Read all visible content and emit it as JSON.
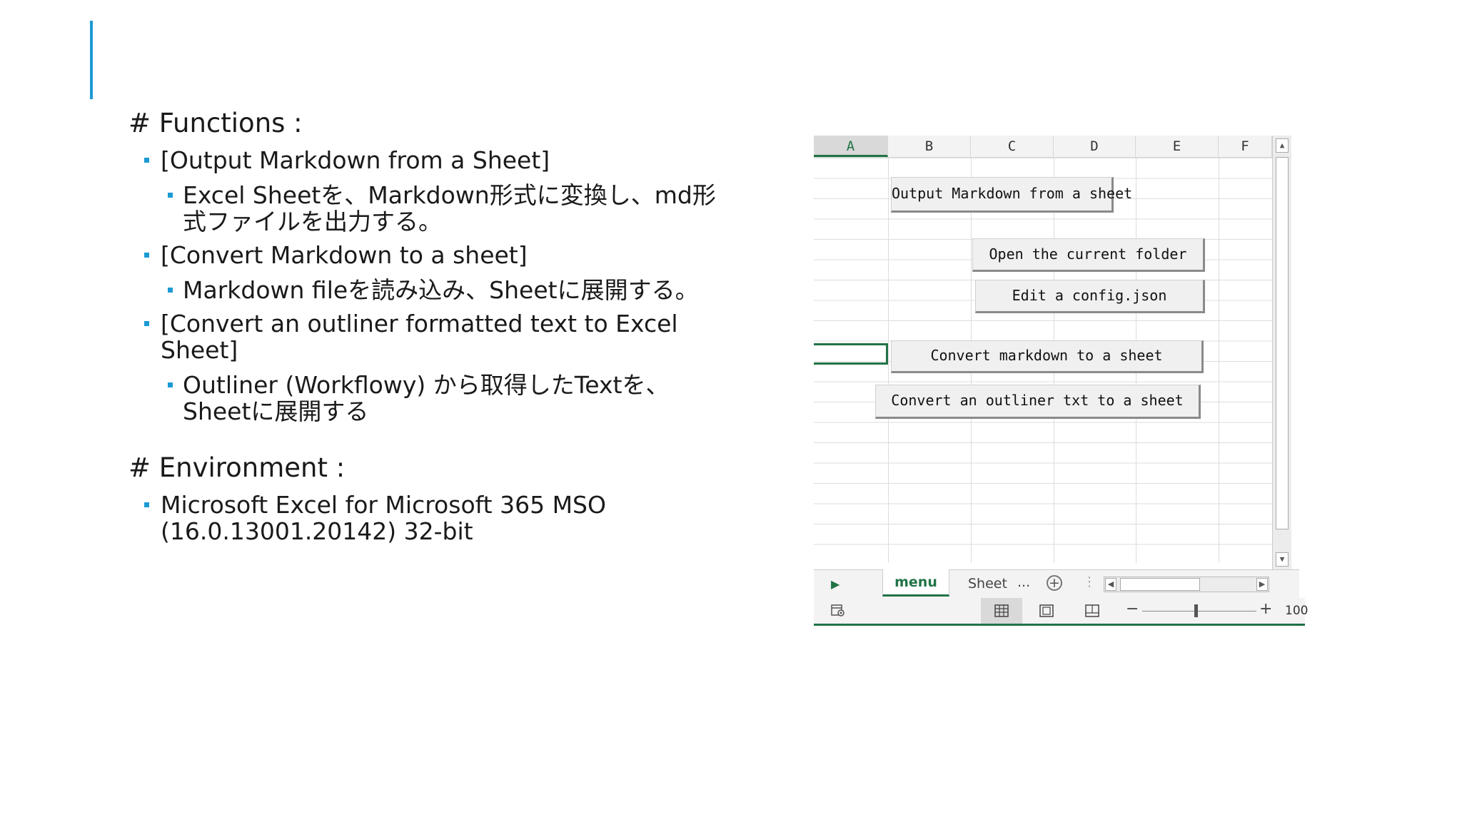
{
  "functions": {
    "heading": "# Functions :",
    "items": [
      {
        "title": "[Output Markdown from a Sheet]",
        "detail": " Excel Sheetを、Markdown形式に変換し、md形式ファイルを出力する。"
      },
      {
        "title": "[Convert Markdown to a sheet]",
        "detail": "Markdown fileを読み込み、Sheetに展開する。"
      },
      {
        "title": "[Convert an outliner formatted text to Excel Sheet]",
        "detail": "Outliner (Workflowy) から取得したTextを、Sheetに展開する"
      }
    ]
  },
  "environment": {
    "heading": "# Environment :",
    "item": "Microsoft Excel for Microsoft 365 MSO (16.0.13001.20142) 32-bit"
  },
  "excel": {
    "columns": [
      "A",
      "B",
      "C",
      "D",
      "E",
      "F"
    ],
    "buttons": {
      "output_markdown": "Output Markdown from a sheet",
      "open_folder": "Open the current folder",
      "edit_config": "Edit a config.json",
      "convert_markdown": "Convert markdown to a sheet",
      "convert_outliner": "Convert an outliner txt to a sheet"
    },
    "sheet_tabs": {
      "active": "menu",
      "other": "Sheet",
      "more": "..."
    },
    "zoom_level": "100"
  },
  "colors": {
    "accent": "#1b9ad4",
    "excel_green": "#217346"
  }
}
